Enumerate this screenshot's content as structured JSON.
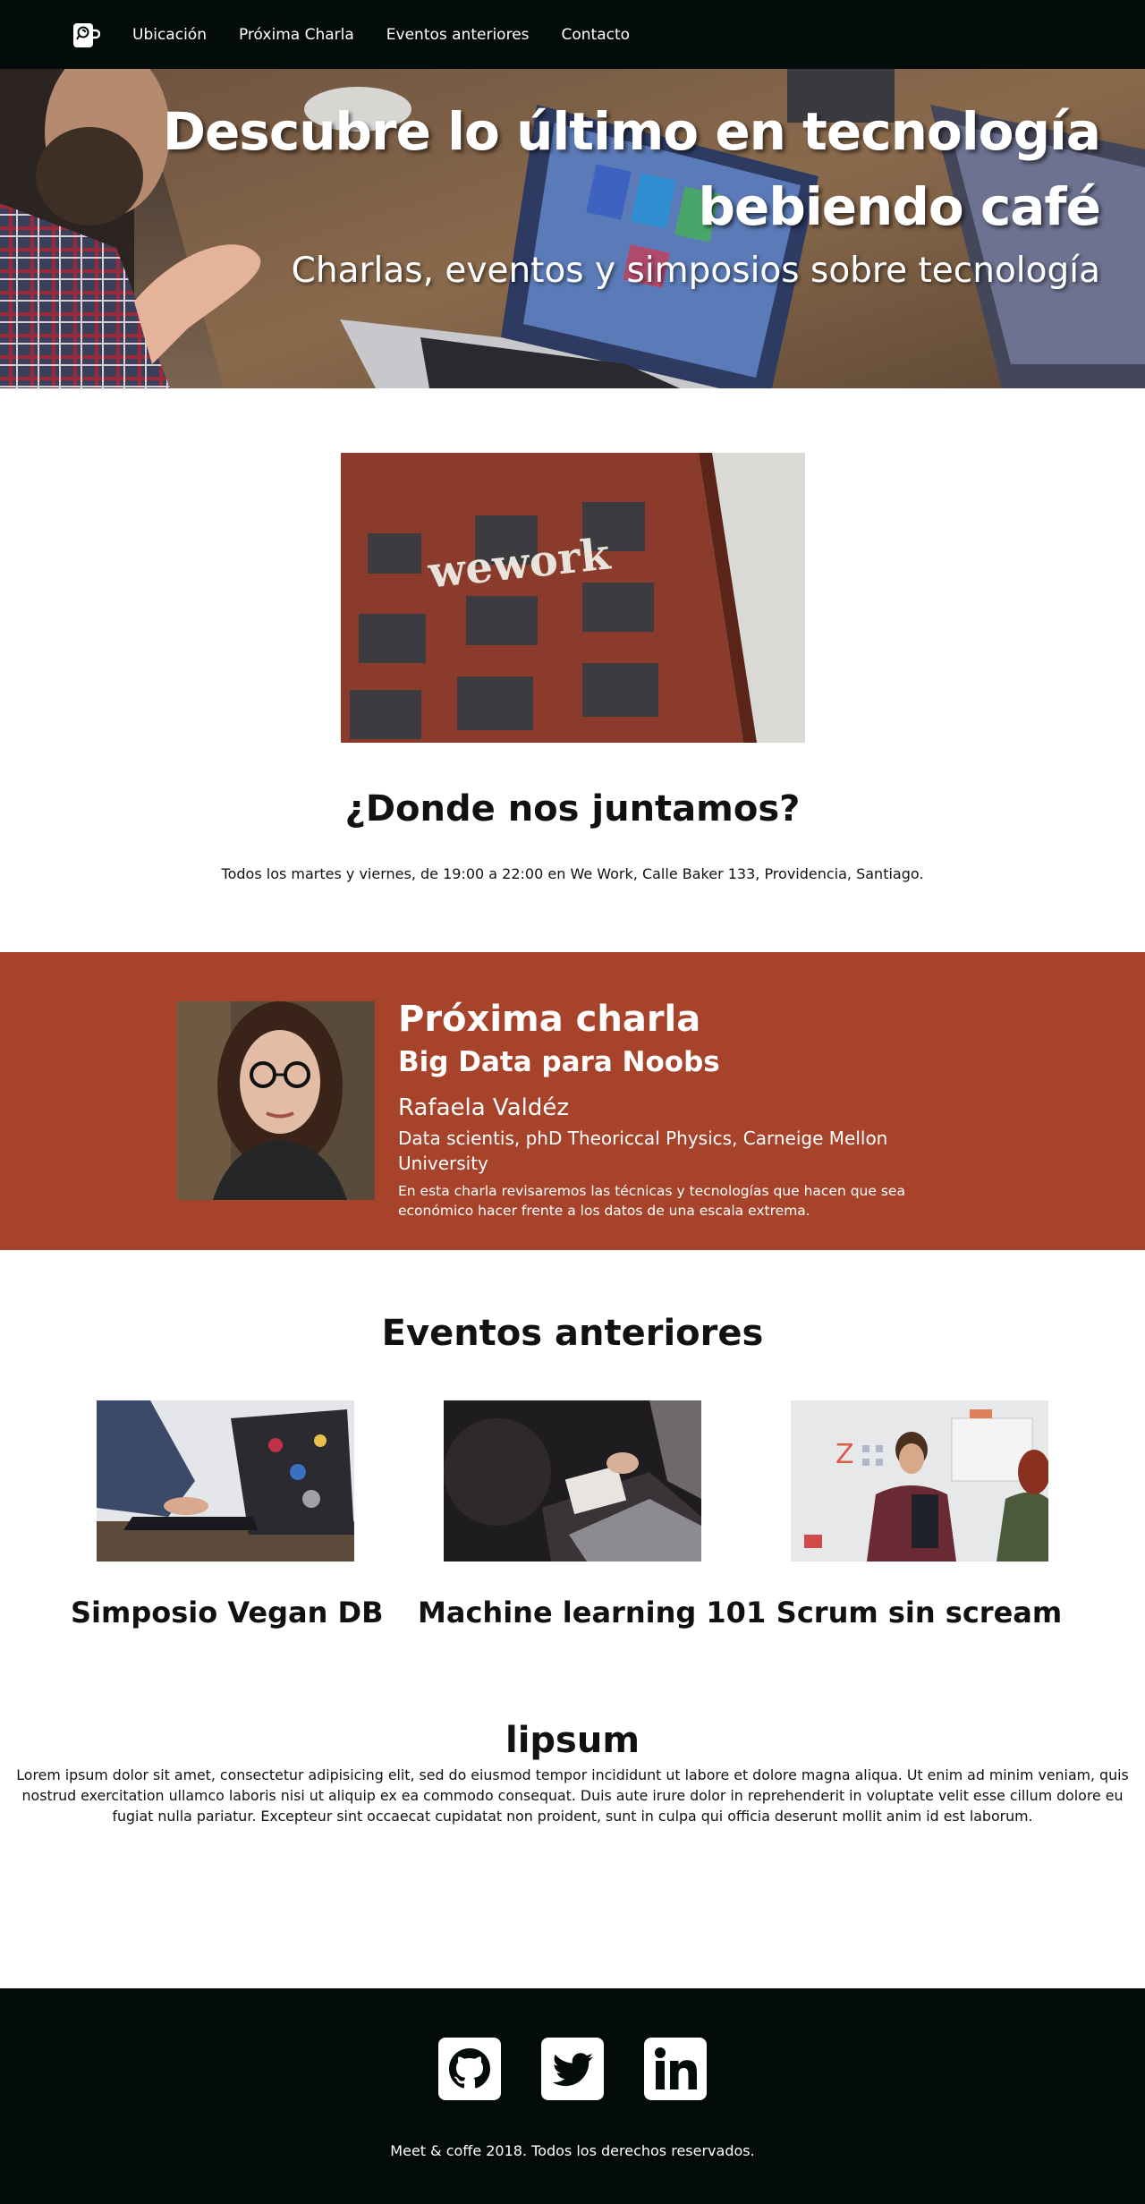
{
  "nav": {
    "logo_icon": "coffee-mug-icon",
    "links": [
      "Ubicación",
      "Próxima Charla",
      "Eventos anteriores",
      "Contacto"
    ]
  },
  "hero": {
    "title_line1": "Descubre lo último en tecnología",
    "title_line2": "bebiendo café",
    "subtitle": "Charlas, eventos y simposios sobre tecnología"
  },
  "location": {
    "building_sign": "wework",
    "title": "¿Donde nos juntamos?",
    "text": "Todos los martes y viernes, de 19:00 a 22:00 en We Work, Calle Baker 133, Providencia, Santiago."
  },
  "next_talk": {
    "heading": "Próxima charla",
    "title": "Big Data para Noobs",
    "speaker": "Rafaela Valdéz",
    "credentials": "Data scientis, phD Theoriccal Physics, Carneige Mellon University",
    "description": "En esta charla revisaremos las técnicas y tecnologías que hacen que sea económico hacer frente a los datos de una escala extrema.",
    "bg_color": "#a6432a"
  },
  "past_events": {
    "title": "Eventos anteriores",
    "items": [
      {
        "name": "Simposio Vegan DB"
      },
      {
        "name": "Machine learning 101"
      },
      {
        "name": "Scrum sin scream"
      }
    ]
  },
  "lipsum": {
    "title": "lipsum",
    "text": "Lorem ipsum dolor sit amet, consectetur adipisicing elit, sed do eiusmod tempor incididunt ut labore et dolore magna aliqua. Ut enim ad minim veniam, quis nostrud exercitation ullamco laboris nisi ut aliquip ex ea commodo consequat. Duis aute irure dolor in reprehenderit in voluptate velit esse cillum dolore eu fugiat nulla pariatur. Excepteur sint occaecat cupidatat non proident, sunt in culpa qui officia deserunt mollit anim id est laborum."
  },
  "footer": {
    "social_icons": [
      "github-icon",
      "twitter-icon",
      "linkedin-icon"
    ],
    "copyright": "Meet & coffe 2018. Todos los derechos reservados."
  }
}
